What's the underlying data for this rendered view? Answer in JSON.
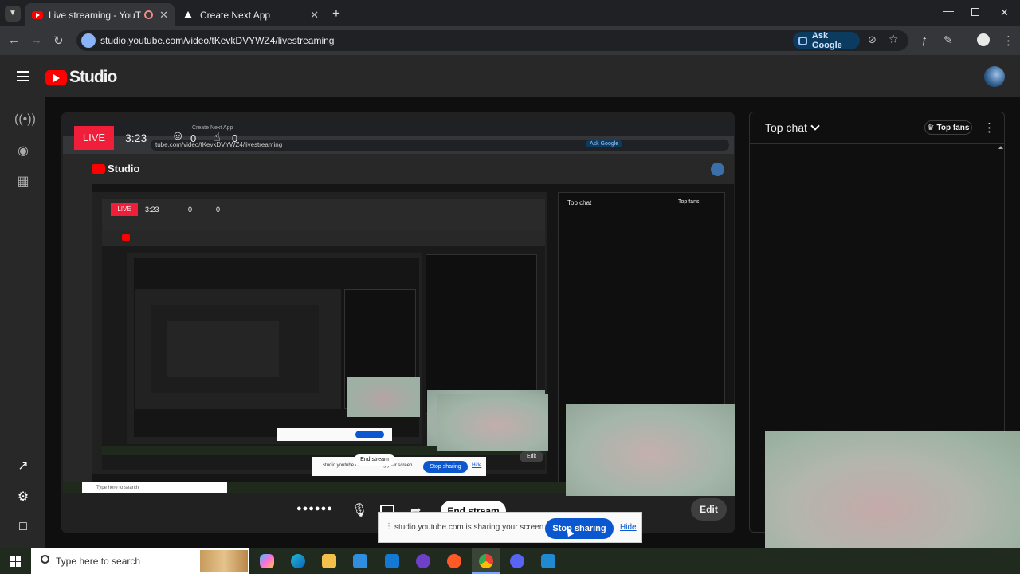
{
  "browser": {
    "tabs": [
      {
        "title": "Live streaming - YouTube S",
        "active": true
      },
      {
        "title": "Create Next App",
        "active": false
      }
    ],
    "url": "studio.youtube.com/video/tKevkDVYWZ4/livestreaming",
    "ask_google_label": "Ask Google"
  },
  "header": {
    "logo_text": "Studio"
  },
  "player": {
    "live_badge": "LIVE",
    "elapsed": "3:23",
    "viewers": "0",
    "likes": "0",
    "end_stream_label": "End stream",
    "edit_label": "Edit"
  },
  "share_bar": {
    "message": "studio.youtube.com is sharing your screen.",
    "stop_label": "Stop sharing",
    "hide_label": "Hide"
  },
  "chat": {
    "title": "Top chat",
    "top_fans_label": "Top fans"
  },
  "taskbar": {
    "search_placeholder": "Type here to search"
  },
  "mirror": {
    "tab2_title": "Create Next App",
    "url": "tube.com/video/tKevkDVYWZ4/livestreaming",
    "ask_google_label": "Ask Google",
    "logo_text": "Studio",
    "live_badge": "LIVE",
    "elapsed": "3:23",
    "viewers": "0",
    "likes": "0",
    "chat_title": "Top chat",
    "top_fans_label": "Top fans",
    "share_message": "studio.youtube.com is sharing your screen.",
    "stop_label": "Stop sharing",
    "hide_label": "Hide",
    "end_stream_label": "End stream",
    "edit_label": "Edit",
    "search_placeholder": "Type here to search"
  },
  "colors": {
    "live_red": "#f11e3a",
    "youtube_red": "#ff0000",
    "accent_blue": "#065fd4",
    "link_blue": "#3ea6ff"
  }
}
